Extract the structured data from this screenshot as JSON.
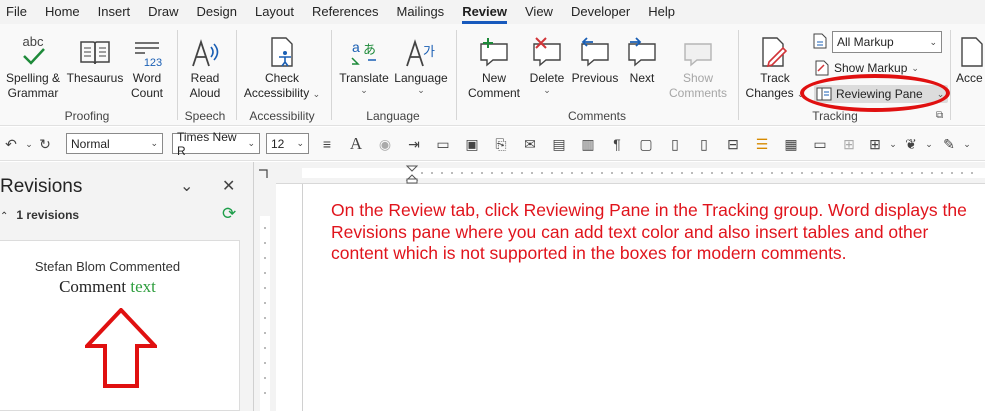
{
  "menu": [
    "File",
    "Home",
    "Insert",
    "Draw",
    "Design",
    "Layout",
    "References",
    "Mailings",
    "Review",
    "View",
    "Developer",
    "Help"
  ],
  "active_tab": "Review",
  "ribbon": {
    "proofing": {
      "spelling_l1": "Spelling &",
      "spelling_l2": "Grammar",
      "spelling_icon_text": "abc",
      "thesaurus": "Thesaurus",
      "word_count_l1": "Word",
      "word_count_l2": "Count",
      "word_count_icon_text": "123",
      "label": "Proofing"
    },
    "speech": {
      "read_l1": "Read",
      "read_l2": "Aloud",
      "label": "Speech"
    },
    "accessibility": {
      "check_l1": "Check",
      "check_l2": "Accessibility",
      "label": "Accessibility"
    },
    "language": {
      "translate": "Translate",
      "language": "Language",
      "label": "Language"
    },
    "comments": {
      "new_l1": "New",
      "new_l2": "Comment",
      "delete": "Delete",
      "previous": "Previous",
      "next": "Next",
      "show_l1": "Show",
      "show_l2": "Comments",
      "label": "Comments"
    },
    "tracking": {
      "track_l1": "Track",
      "track_l2": "Changes",
      "markup_select": "All Markup",
      "show_markup": "Show Markup",
      "reviewing_pane": "Reviewing Pane",
      "label": "Tracking"
    },
    "accessibility_cut": "Acce"
  },
  "qat": {
    "style": "Normal",
    "font": "Times New R",
    "size": "12"
  },
  "revisions_pane": {
    "title": "Revisions",
    "count": "1 revisions",
    "author_line": "Stefan Blom Commented",
    "comment_black": "Comment",
    "comment_green": "text"
  },
  "annotation_text": "On the Review tab, click Reviewing Pane in the Tracking group. Word displays the Revisions pane where you can add text color and also insert tables and other content which is not supported in the boxes for modern comments.",
  "colors": {
    "accent": "#185abd",
    "annotation": "#e0141c",
    "highlight": "#e01010",
    "comment_green": "#2e9e3e"
  }
}
